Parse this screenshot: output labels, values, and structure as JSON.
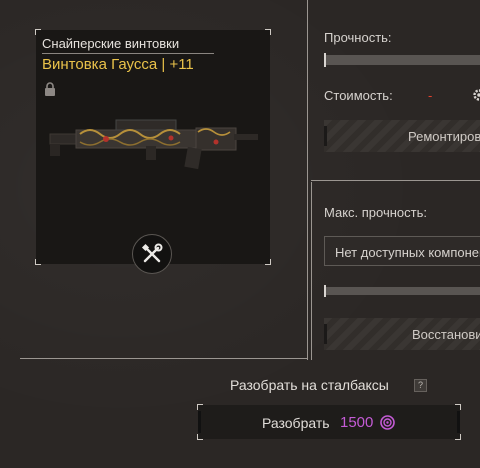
{
  "item": {
    "category": "Снайперские винтовки",
    "name": "Винтовка Гаусса | +11"
  },
  "repair": {
    "durability_label": "Прочность:",
    "cost_label": "Стоимость:",
    "cost_value": "-",
    "repair_button_label": "Ремонтировать"
  },
  "restore": {
    "max_durability_label": "Макс. прочность:",
    "components_select_value": "Нет доступных компонентов",
    "restore_button_label": "Восстановить"
  },
  "disassemble": {
    "title": "Разобрать на сталбаксы",
    "help_mark": "?",
    "button_label": "Разобрать",
    "price": "1500"
  },
  "colors": {
    "item_name": "#e9c24a",
    "price": "#c45bd6",
    "cost_dash": "#e2402e"
  }
}
